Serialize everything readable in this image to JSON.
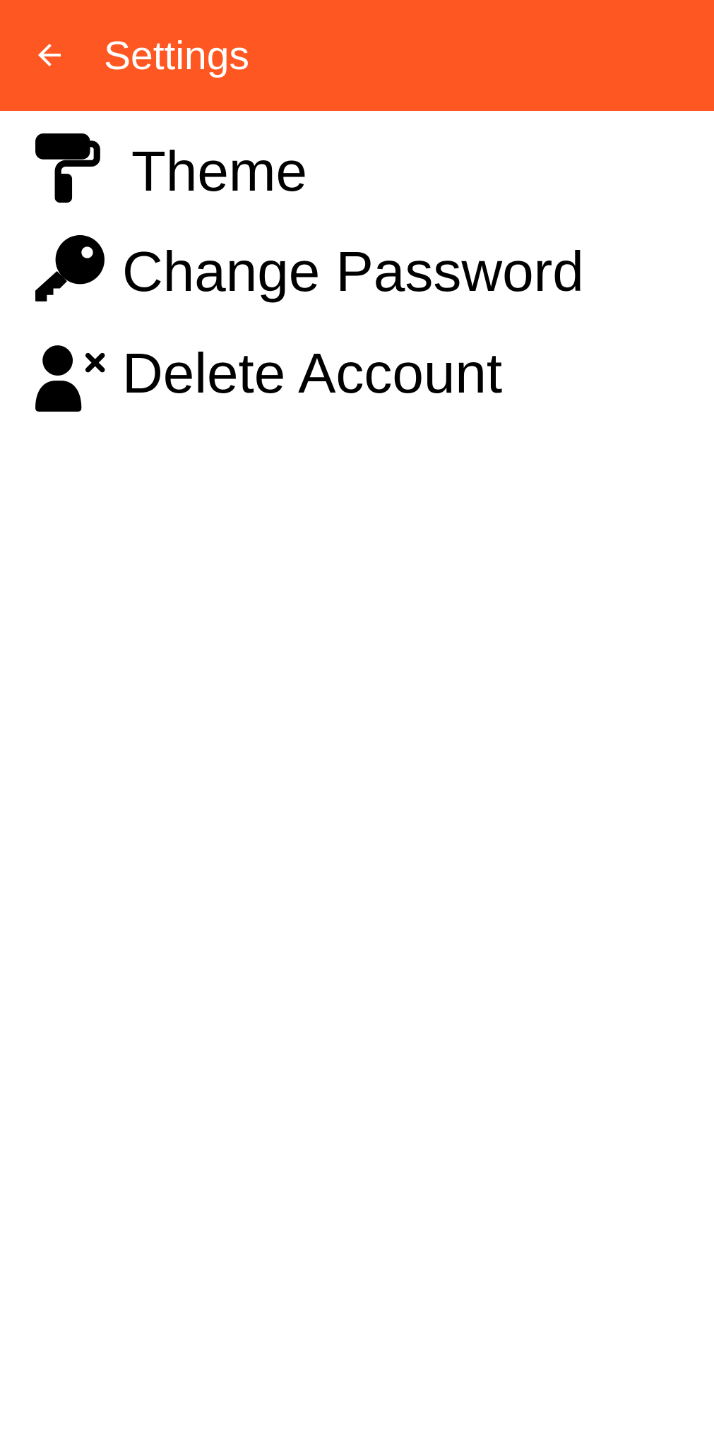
{
  "app_bar": {
    "title": "Settings",
    "back_icon": "arrow-left-icon",
    "background_color": "#ff5722"
  },
  "settings": {
    "items": [
      {
        "label": "Theme",
        "icon": "paint-roller-icon"
      },
      {
        "label": "Change Password",
        "icon": "key-icon"
      },
      {
        "label": "Delete Account",
        "icon": "user-remove-icon"
      }
    ]
  }
}
